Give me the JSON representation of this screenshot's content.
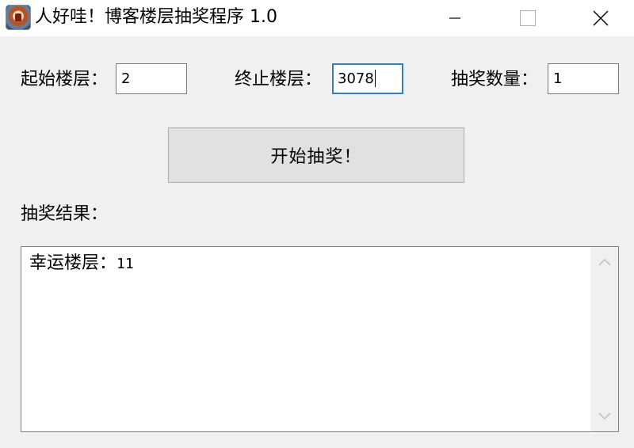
{
  "window": {
    "title": "人好哇！博客楼层抽奖程序 1.0",
    "icon": "app-icon"
  },
  "form": {
    "start_label": "起始楼层：",
    "start_value": "2",
    "end_label": "终止楼层：",
    "end_value": "3078",
    "count_label": "抽奖数量：",
    "count_value": "1"
  },
  "actions": {
    "draw_button": "开始抽奖！"
  },
  "results": {
    "heading": "抽奖结果：",
    "line_label": "幸运楼层：",
    "line_value": "11"
  },
  "colors": {
    "focus_border": "#3d7ab8",
    "window_bg": "#f0f0f0",
    "button_bg": "#e1e1e1"
  }
}
